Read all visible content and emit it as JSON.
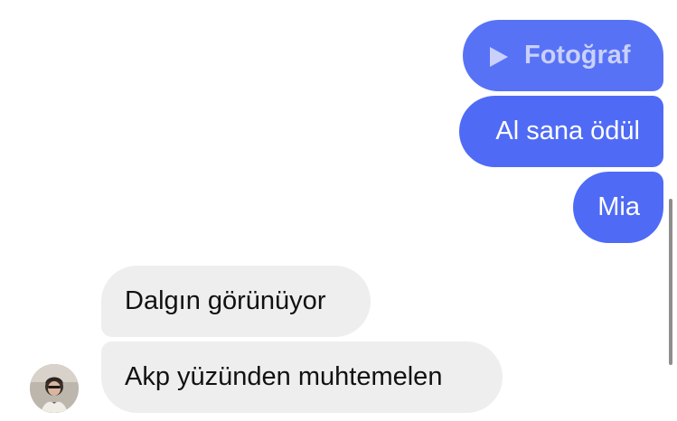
{
  "messages": {
    "outgoing": [
      {
        "type": "photo",
        "label": "Fotoğraf",
        "icon": "play-icon"
      },
      {
        "type": "text",
        "text": "Al sana ödül"
      },
      {
        "type": "text",
        "text": "Mia"
      }
    ],
    "incoming": [
      {
        "type": "text",
        "text": "Dalgın görünüyor"
      },
      {
        "type": "text",
        "text": "Akp yüzünden muhtemelen"
      }
    ]
  },
  "colors": {
    "outgoing_bubble": "#4F6BF5",
    "incoming_bubble": "#EEEEEE",
    "background": "#FFFFFF"
  }
}
